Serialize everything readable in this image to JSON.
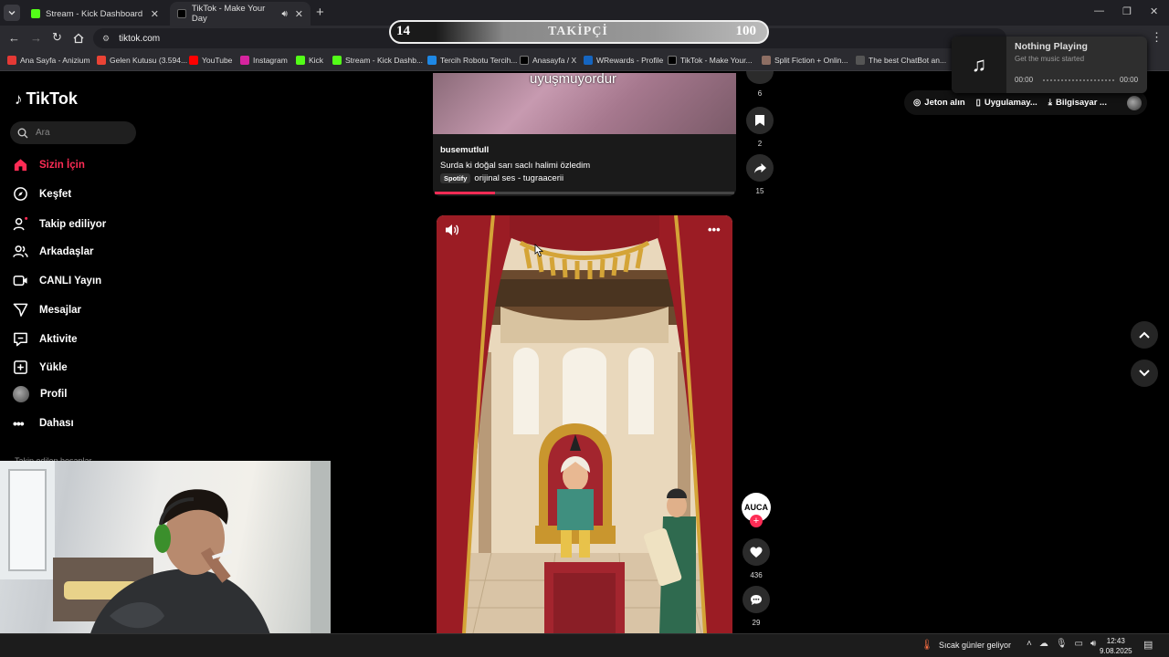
{
  "browser": {
    "tabs": [
      {
        "title": "Stream - Kick Dashboard",
        "active": false
      },
      {
        "title": "TikTok - Make Your Day",
        "active": true
      }
    ],
    "address": "tiktok.com",
    "bookmarks": [
      {
        "label": "Ana Sayfa - Anizium",
        "color": "#e53935"
      },
      {
        "label": "Gelen Kutusu (3.594...",
        "color": "#ea4335"
      },
      {
        "label": "YouTube",
        "color": "#ff0000"
      },
      {
        "label": "Instagram",
        "color": "#d6249f"
      },
      {
        "label": "Kick",
        "color": "#53fc18"
      },
      {
        "label": "Stream - Kick Dashb...",
        "color": "#53fc18"
      },
      {
        "label": "Tercih Robotu Tercih...",
        "color": "#1e88e5"
      },
      {
        "label": "Anasayfa / X",
        "color": "#000000"
      },
      {
        "label": "WRewards - Profile",
        "color": "#1565c0"
      },
      {
        "label": "TikTok - Make Your...",
        "color": "#000000"
      },
      {
        "label": "Split Fiction + Onlin...",
        "color": "#8d6e63"
      },
      {
        "label": "The best ChatBot an...",
        "color": "#555555"
      }
    ]
  },
  "overlay": {
    "follower_current": "14",
    "follower_label": "TAKİPÇİ",
    "follower_goal": "100"
  },
  "media_popup": {
    "title": "Nothing Playing",
    "subtitle": "Get the music started",
    "time_start": "00:00",
    "time_end": "00:00"
  },
  "header_actions": {
    "coins": "Jeton alın",
    "app": "Uygulamay...",
    "desktop": "Bilgisayar ..."
  },
  "sidebar": {
    "logo": "TikTok",
    "search_placeholder": "Ara",
    "items": [
      {
        "label": "Sizin İçin",
        "icon": "home-icon",
        "active": true
      },
      {
        "label": "Keşfet",
        "icon": "compass-icon"
      },
      {
        "label": "Takip ediliyor",
        "icon": "user-follow-icon"
      },
      {
        "label": "Arkadaşlar",
        "icon": "friends-icon"
      },
      {
        "label": "CANLI Yayın",
        "icon": "live-icon"
      },
      {
        "label": "Mesajlar",
        "icon": "message-icon"
      },
      {
        "label": "Aktivite",
        "icon": "activity-icon"
      },
      {
        "label": "Yükle",
        "icon": "upload-icon"
      },
      {
        "label": "Profil",
        "icon": "avatar"
      },
      {
        "label": "Dahası",
        "icon": "more-icon"
      }
    ],
    "following_header": "Takip edilen hesaplar"
  },
  "video1": {
    "overlay_text": "uyuşmuyordur",
    "username": "busemutlull",
    "caption": "Surda ki doğal sarı saclı halimi özledim",
    "spotify_badge": "Spotify",
    "sound": "orijinal ses - tugraacerii",
    "comments": "6",
    "bookmarks": "2",
    "shares": "15"
  },
  "video2": {
    "creator_badge": "AUCA",
    "likes": "436",
    "comments": "29"
  },
  "taskbar": {
    "weather": "Sıcak günler geliyor",
    "time": "12:43",
    "date": "9.08.2025"
  },
  "colors": {
    "accent": "#fe2c55",
    "bg": "#000000",
    "chrome": "#2b2b30"
  }
}
